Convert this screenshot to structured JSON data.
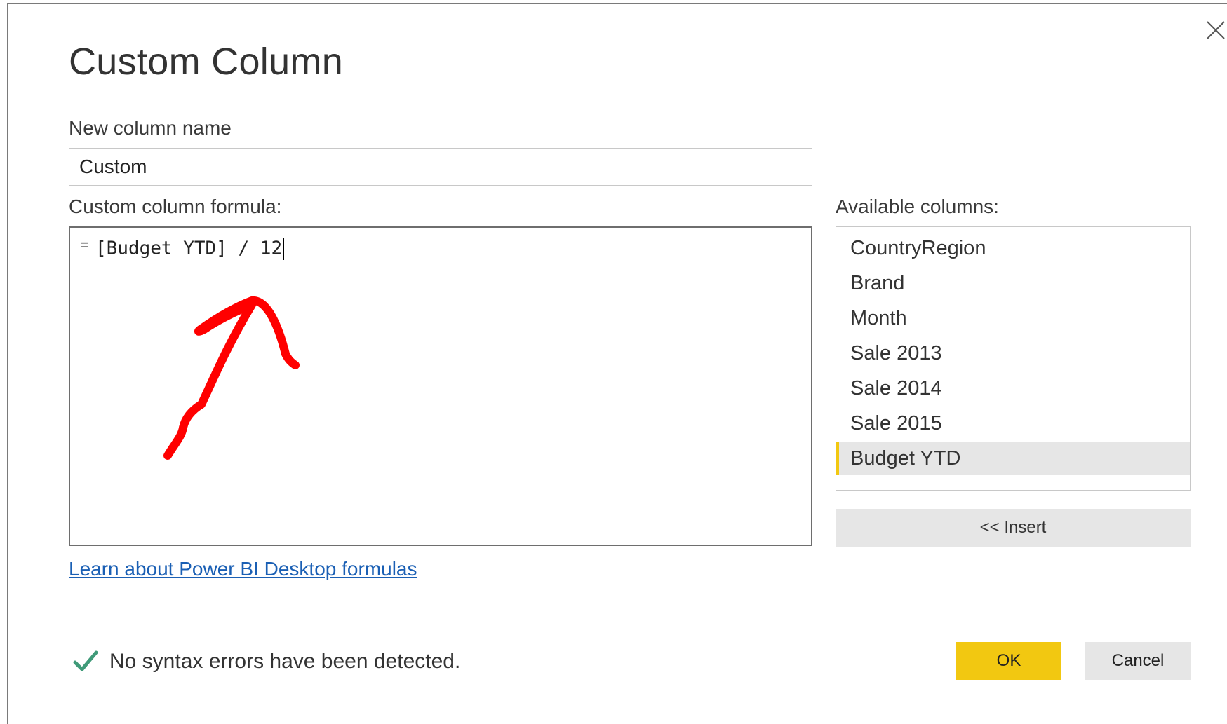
{
  "dialog": {
    "title": "Custom Column",
    "close_icon": "close-icon"
  },
  "name_field": {
    "label": "New column name",
    "value": "Custom"
  },
  "formula": {
    "label": "Custom column formula:",
    "prefix": "=",
    "expression": "[Budget YTD] / 12"
  },
  "annotation": {
    "type": "red-hand-drawn-arrow",
    "color": "#ff0000"
  },
  "available_columns": {
    "label": "Available columns:",
    "items": [
      {
        "label": "CountryRegion",
        "selected": false
      },
      {
        "label": "Brand",
        "selected": false
      },
      {
        "label": "Month",
        "selected": false
      },
      {
        "label": "Sale 2013",
        "selected": false
      },
      {
        "label": "Sale 2014",
        "selected": false
      },
      {
        "label": "Sale 2015",
        "selected": false
      },
      {
        "label": "Budget YTD",
        "selected": true
      }
    ],
    "insert_label": "<< Insert"
  },
  "help_link": {
    "label": "Learn about Power BI Desktop formulas"
  },
  "status": {
    "icon": "checkmark-icon",
    "message": "No syntax errors have been detected.",
    "color": "#3f9a78"
  },
  "footer": {
    "ok_label": "OK",
    "cancel_label": "Cancel"
  },
  "colors": {
    "accent": "#f2c811",
    "link": "#1a5fb4",
    "selection_bg": "#e6e6e6"
  }
}
